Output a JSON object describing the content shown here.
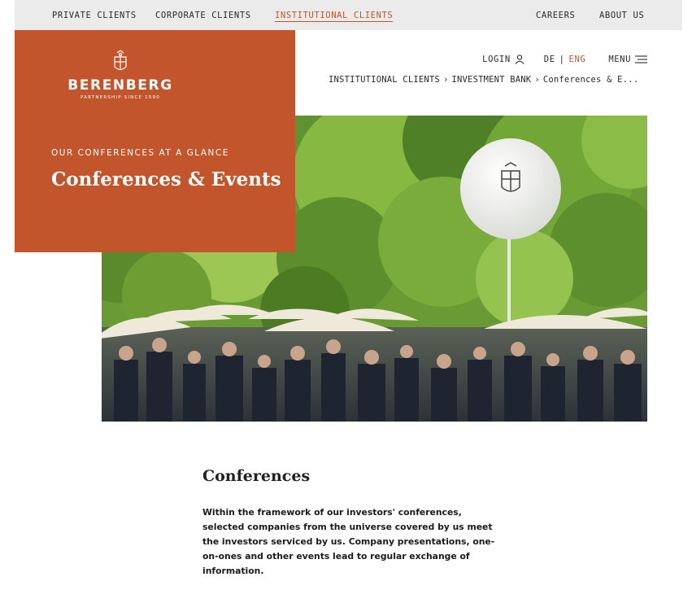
{
  "top_nav": {
    "left": [
      "PRIVATE CLIENTS",
      "CORPORATE CLIENTS",
      "INSTITUTIONAL CLIENTS"
    ],
    "active": "INSTITUTIONAL CLIENTS",
    "right": [
      "CAREERS",
      "ABOUT US"
    ]
  },
  "brand": {
    "name": "BERENBERG",
    "tagline": "PARTNERSHIP SINCE 1590",
    "color": "#c2552c"
  },
  "utility": {
    "login": "LOGIN",
    "login_icon": "user-icon",
    "lang_de": "DE",
    "lang_sep": "|",
    "lang_eng": "ENG",
    "active_language": "ENG",
    "menu": "MENU",
    "menu_icon": "hamburger-icon"
  },
  "breadcrumb": {
    "items": [
      "INSTITUTIONAL CLIENTS",
      "INVESTMENT BANK",
      "Conferences & E..."
    ],
    "separator": "›"
  },
  "hero": {
    "kicker": "OUR CONFERENCES AT A GLANCE",
    "title": "Conferences & Events"
  },
  "content": {
    "section_title": "Conferences",
    "intro": "Within the framework of our investors' conferences, selected companies from the universe covered by us meet the investors serviced by us. Company presentations, one-on-ones and other events lead to regular exchange of information."
  }
}
